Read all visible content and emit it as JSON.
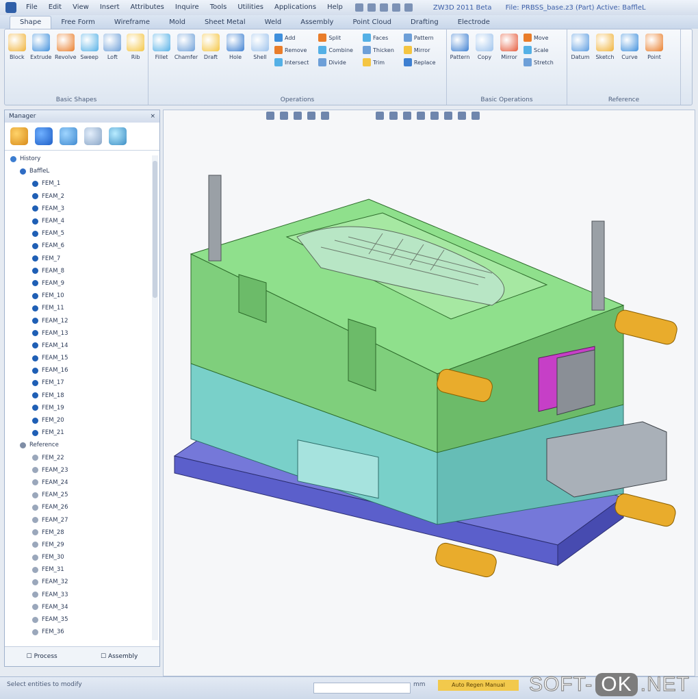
{
  "menu": {
    "items": [
      "File",
      "Edit",
      "View",
      "Insert",
      "Attributes",
      "Inquire",
      "Tools",
      "Utilities",
      "Applications",
      "Help"
    ]
  },
  "window": {
    "title": "ZW3D 2011 Beta",
    "document": "File: PRBSS_base.z3 (Part)  Active: BaffleL"
  },
  "ribbon": {
    "tabs": [
      "Shape",
      "Free Form",
      "Wireframe",
      "Mold",
      "Sheet Metal",
      "Weld",
      "Assembly",
      "Point Cloud",
      "Drafting",
      "Electrode"
    ],
    "active_tab": "Shape",
    "groups": [
      {
        "label": "Basic Shapes",
        "buttons": [
          {
            "label": "Block",
            "icon": "block-icon"
          },
          {
            "label": "Extrude",
            "icon": "extrude-icon"
          },
          {
            "label": "Revolve",
            "icon": "revolve-icon"
          },
          {
            "label": "Sweep",
            "icon": "sweep-icon"
          },
          {
            "label": "Loft",
            "icon": "loft-icon"
          },
          {
            "label": "Rib",
            "icon": "rib-icon"
          }
        ]
      },
      {
        "label": "Operations",
        "big": [
          {
            "label": "Fillet",
            "icon": "fillet-icon"
          },
          {
            "label": "Chamfer",
            "icon": "chamfer-icon"
          },
          {
            "label": "Draft",
            "icon": "draft-icon"
          },
          {
            "label": "Hole",
            "icon": "hole-icon"
          },
          {
            "label": "Shell",
            "icon": "shell-icon"
          }
        ],
        "small": [
          [
            "Add",
            "Remove",
            "Intersect"
          ],
          [
            "Split",
            "Combine",
            "Divide"
          ],
          [
            "Faces",
            "Thicken",
            "Trim"
          ],
          [
            "Pattern",
            "Mirror",
            "Replace"
          ]
        ]
      },
      {
        "label": "Basic Operations",
        "big": [
          {
            "label": "Pattern",
            "icon": "pattern-icon"
          },
          {
            "label": "Copy",
            "icon": "copy-icon"
          },
          {
            "label": "Mirror",
            "icon": "mirror-icon"
          }
        ],
        "small": [
          [
            "Move",
            "Scale",
            "Stretch"
          ]
        ]
      },
      {
        "label": "Reference",
        "big": [
          {
            "label": "Datum",
            "icon": "datum-icon"
          },
          {
            "label": "Sketch",
            "icon": "sketch-icon"
          },
          {
            "label": "Curve",
            "icon": "curve-icon"
          },
          {
            "label": "Point",
            "icon": "point-icon"
          }
        ]
      }
    ]
  },
  "manager": {
    "title": "Manager",
    "root": "History",
    "part": "BaffleL",
    "features": [
      "FEM_1",
      "FEAM_2",
      "FEAM_3",
      "FEAM_4",
      "FEAM_5",
      "FEAM_6",
      "FEM_7",
      "FEAM_8",
      "FEAM_9",
      "FEM_10",
      "FEM_11",
      "FEAM_12",
      "FEAM_13",
      "FEAM_14",
      "FEAM_15",
      "FEAM_16",
      "FEM_17",
      "FEM_18",
      "FEM_19",
      "FEM_20",
      "FEM_21"
    ],
    "group2": "Reference",
    "group2_features": [
      "FEM_22",
      "FEAM_23",
      "FEAM_24",
      "FEAM_25",
      "FEAM_26",
      "FEAM_27",
      "FEM_28",
      "FEM_29",
      "FEM_30",
      "FEM_31",
      "FEAM_32",
      "FEAM_33",
      "FEAM_34",
      "FEAM_35",
      "FEM_36"
    ],
    "footer": [
      "Process",
      "Assembly"
    ]
  },
  "status": {
    "left": "Select entities to modify",
    "units": "mm",
    "alert": "Auto Regen Manual"
  },
  "watermark": {
    "pre": "SOFT-",
    "ok": "OK",
    ".net": ".NET"
  },
  "colors": {
    "cavity": "#7fcf7c",
    "core": "#79d0c9",
    "base": "#5b5fcb",
    "guide_pin": "#e9ac2c",
    "slider": "#c63fc7",
    "ribbon_bg": "#e6edf6"
  }
}
